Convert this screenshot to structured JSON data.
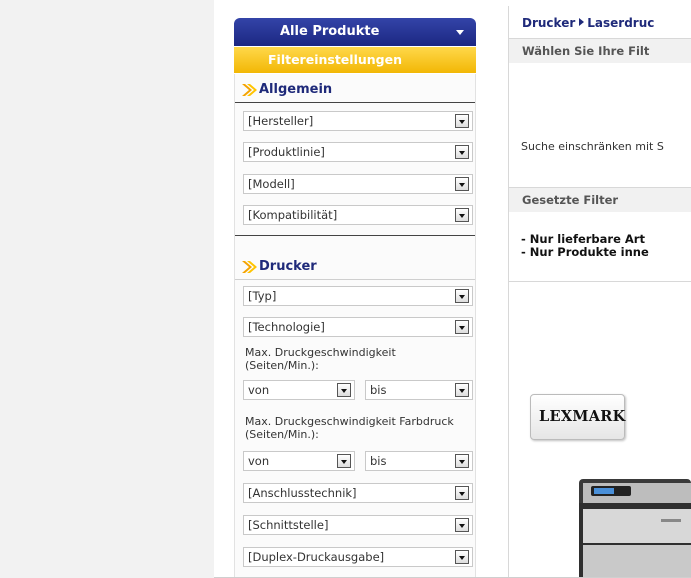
{
  "sidebar": {
    "all_products": "Alle Produkte",
    "filter_settings": "Filtereinstellungen",
    "sections": {
      "general": {
        "title": "Allgemein",
        "selects": [
          "[Hersteller]",
          "[Produktlinie]",
          "[Modell]",
          "[Kompatibilität]"
        ]
      },
      "printer": {
        "title": "Drucker",
        "type": "[Typ]",
        "technology": "[Technologie]",
        "speed_label": "Max. Druckgeschwindigkeit (Seiten/Min.):",
        "speed_from": "von",
        "speed_to": "bis",
        "color_speed_label": "Max. Druckgeschwindigkeit Farbdruck (Seiten/Min.):",
        "color_speed_from": "von",
        "color_speed_to": "bis",
        "connection": "[Anschlusstechnik]",
        "interface": "[Schnittstelle]",
        "duplex": "[Duplex-Druckausgabe]"
      }
    }
  },
  "content": {
    "breadcrumb": [
      "Drucker",
      "Laserdruc"
    ],
    "choose_filter": "Wählen Sie Ihre Filt",
    "narrow_search": "Suche einschränken mit S",
    "set_filters_title": "Gesetzte Filter",
    "set_filters": [
      "- Nur lieferbare Art",
      "- Nur Produkte inne"
    ],
    "brand_logo": "LEXMARK"
  },
  "colors": {
    "nav_blue": "#1c2782",
    "filter_yellow": "#f2b705",
    "heading_blue": "#1f2a7a",
    "arrow_orange": "#f5a300"
  }
}
